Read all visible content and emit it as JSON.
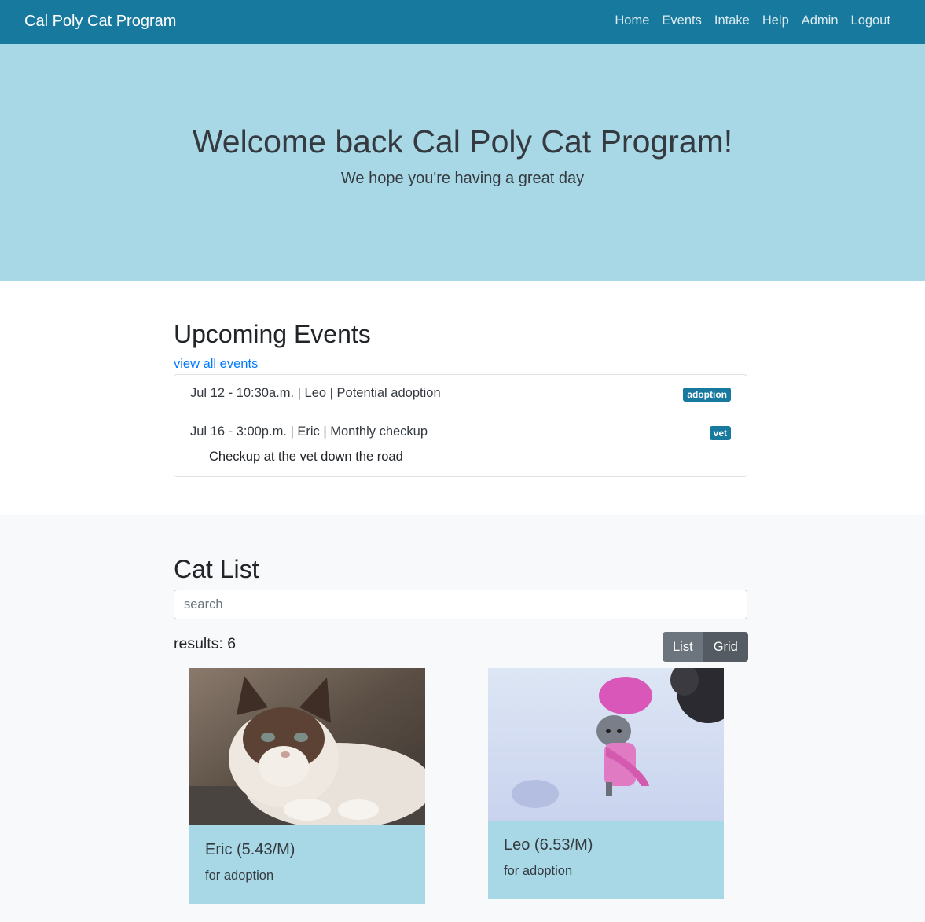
{
  "nav": {
    "brand": "Cal Poly Cat Program",
    "links": [
      "Home",
      "Events",
      "Intake",
      "Help",
      "Admin",
      "Logout"
    ]
  },
  "hero": {
    "title": "Welcome back Cal Poly Cat Program!",
    "subtitle": "We hope you're having a great day"
  },
  "events": {
    "heading": "Upcoming Events",
    "view_all": "view all events",
    "items": [
      {
        "title": "Jul 12 - 10:30a.m. | Leo | Potential adoption",
        "badge": "adoption",
        "description": ""
      },
      {
        "title": "Jul 16 - 3:00p.m. | Eric | Monthly checkup",
        "badge": "vet",
        "description": "Checkup at the vet down the road"
      }
    ]
  },
  "catlist": {
    "heading": "Cat List",
    "search_placeholder": "search",
    "results": "results: 6",
    "view_buttons": {
      "list": "List",
      "grid": "Grid"
    },
    "cards": [
      {
        "name": "Eric (5.43/M)",
        "status": "for adoption"
      },
      {
        "name": "Leo (6.53/M)",
        "status": "for adoption"
      }
    ]
  },
  "colors": {
    "navbar": "#17799e",
    "hero": "#a8d8e5",
    "link": "#007bff"
  }
}
